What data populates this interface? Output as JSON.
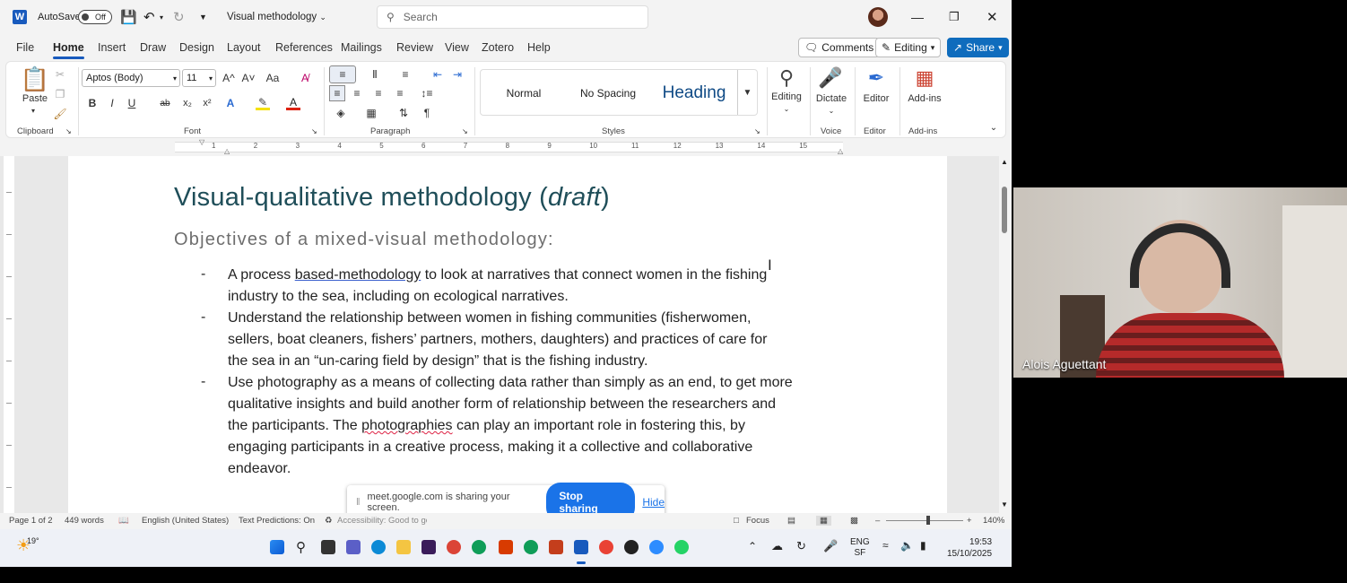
{
  "titlebar": {
    "autosave_label": "AutoSave",
    "autosave_state": "Off",
    "doc_name": "Visual methodology",
    "search_placeholder": "Search"
  },
  "menu": {
    "tabs": [
      "File",
      "Home",
      "Insert",
      "Draw",
      "Design",
      "Layout",
      "References",
      "Mailings",
      "Review",
      "View",
      "Zotero",
      "Help"
    ],
    "active": "Home",
    "comments_label": "Comments",
    "editing_label": "Editing",
    "share_label": "Share"
  },
  "ribbon": {
    "clipboard": {
      "paste": "Paste",
      "label": "Clipboard"
    },
    "font": {
      "name": "Aptos (Body)",
      "size": "11",
      "label": "Font",
      "case": "Aa",
      "bold": "B",
      "italic": "I",
      "underline": "U",
      "strike": "ab",
      "sub": "x₂",
      "sup": "x²",
      "grow": "A^",
      "shrink": "A˅",
      "effects": "A",
      "color": "A"
    },
    "paragraph": {
      "label": "Paragraph"
    },
    "styles": {
      "items": [
        "Normal",
        "No Spacing",
        "Heading"
      ],
      "label": "Styles"
    },
    "editing": {
      "label": "Editing"
    },
    "voice": {
      "dictate": "Dictate",
      "label": "Voice"
    },
    "editor": {
      "editor": "Editor",
      "label": "Editor"
    },
    "addins": {
      "addins": "Add-ins",
      "label": "Add-ins"
    }
  },
  "ruler": {
    "numbers": [
      "1",
      "2",
      "3",
      "4",
      "5",
      "6",
      "7",
      "8",
      "9",
      "10",
      "11",
      "12",
      "13",
      "14",
      "15"
    ]
  },
  "document": {
    "title_main": "Visual-qualitative methodology (",
    "title_italic": "draft",
    "title_end": ")",
    "subtitle": "Objectives of a mixed-visual methodology:",
    "bullet_char": "-",
    "bullets": [
      {
        "lines": [
          [
            "A process ",
            "based-methodology",
            " to look at narratives that connect women in the fishing"
          ],
          [
            "industry to the sea, including on ecological narratives."
          ]
        ]
      },
      {
        "lines": [
          [
            "Understand the relationship between women in fishing communities (fisherwomen,"
          ],
          [
            "sellers, boat cleaners, fishers’ partners, mothers, daughters) and practices of care for"
          ],
          [
            "the sea in an “un-caring field by design” that is the fishing industry."
          ]
        ]
      },
      {
        "lines": [
          [
            "Use photography as a means of collecting data rather than simply as an end, to get more"
          ],
          [
            "qualitative insights and build another form of relationship between the researchers and"
          ],
          [
            "the participants. The ",
            "photographies",
            " can play an important role in fostering this, by"
          ],
          [
            "engaging participants in a creative process, making it a collective and collaborative"
          ],
          [
            "endeavor."
          ]
        ]
      }
    ]
  },
  "banner": {
    "message": "meet.google.com is sharing your screen.",
    "stop": "Stop sharing",
    "hide": "Hide"
  },
  "status": {
    "page": "Page 1 of 2",
    "words": "449 words",
    "language": "English (United States)",
    "predictions": "Text Predictions: On",
    "accessibility": "Accessibility: Good to go",
    "focus": "Focus",
    "zoom": "140%"
  },
  "taskbar": {
    "weather": "19°",
    "lang_top": "ENG",
    "lang_bottom": "SF",
    "time": "19:53",
    "date": "15/10/2025"
  },
  "video": {
    "participant_name": "Alois Aguettant"
  },
  "colors": {
    "accent": "#185abd",
    "title": "#1f4e59",
    "share": "#0f6cbd",
    "stop_sharing": "#1a73e8"
  }
}
